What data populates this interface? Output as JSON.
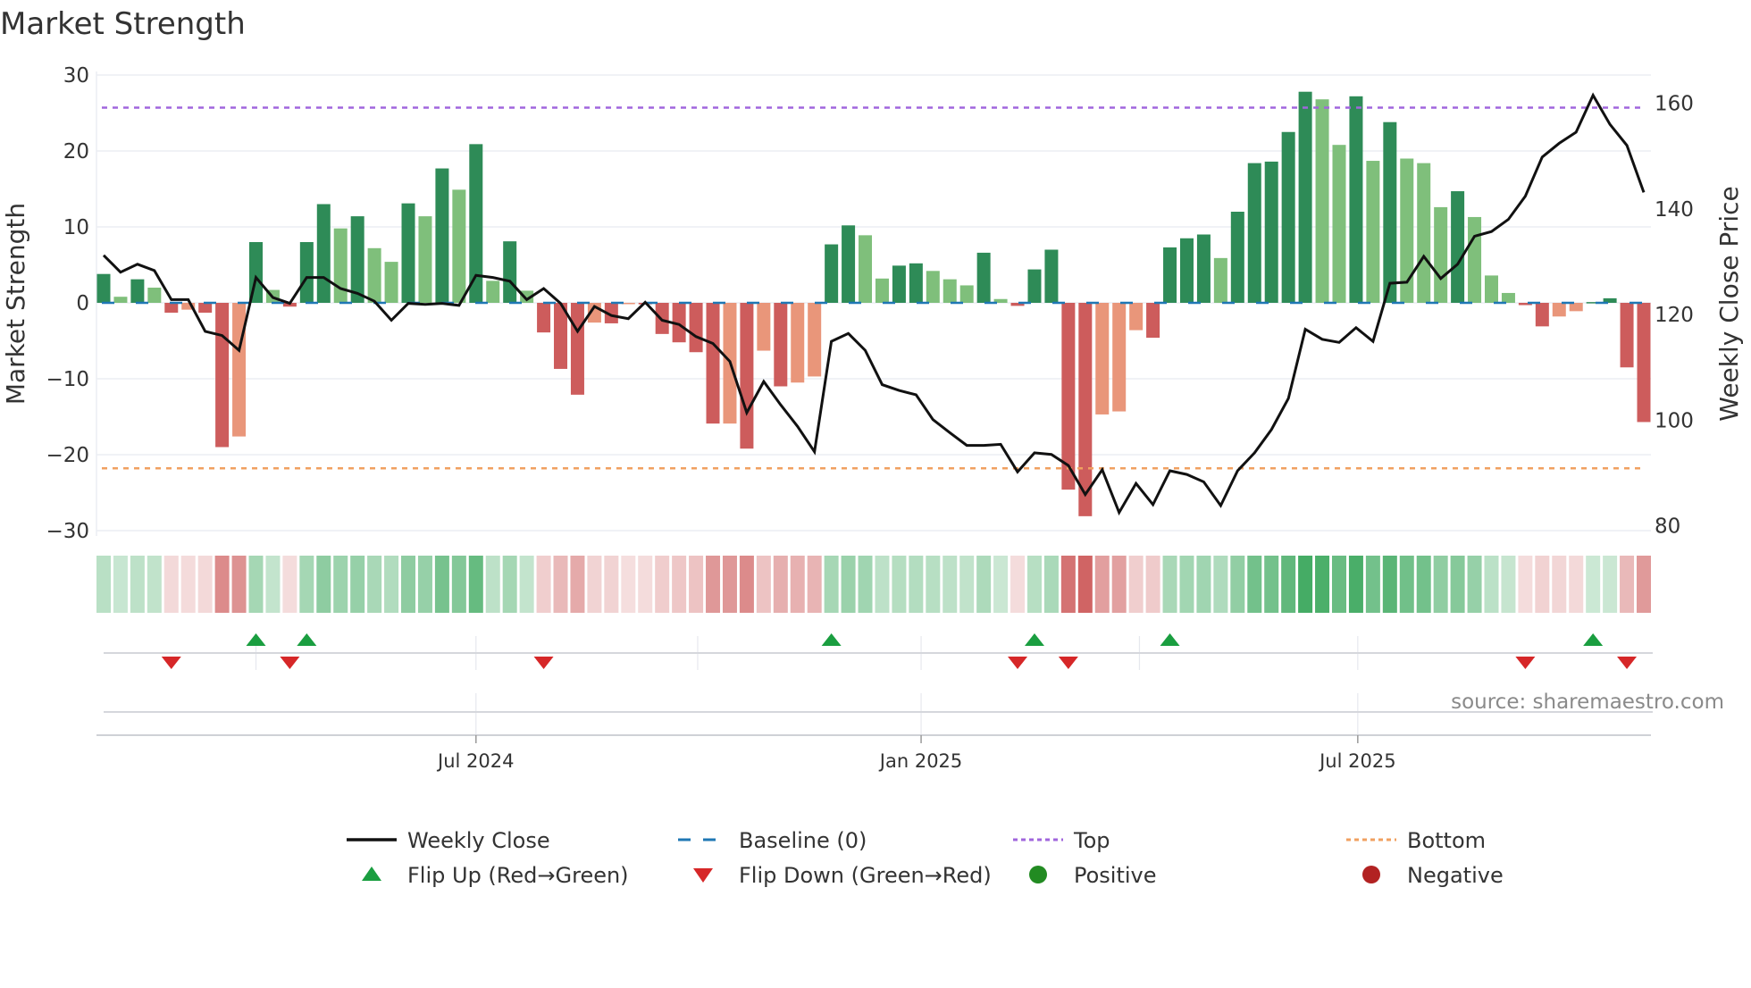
{
  "chart_data": {
    "type": "bar",
    "title": "Market Strength",
    "ylabel": "Market Strength",
    "y2label": "Weekly Close Price",
    "ylim": [
      -30,
      30
    ],
    "y2lim": [
      80,
      160
    ],
    "yticks": [
      30,
      20,
      10,
      0,
      -10,
      -20,
      -30
    ],
    "yticklabels": [
      "30",
      "20",
      "10",
      "0",
      "−10",
      "−20",
      "−30"
    ],
    "y2ticks": [
      160,
      140,
      120,
      100,
      80
    ],
    "y2ticklabels": [
      "160",
      "140",
      "120",
      "100",
      "80"
    ],
    "top_level": 25.7,
    "bottom_level": -21.8,
    "xlabel_ticks": [
      {
        "x": 22,
        "label": "Jul 2024"
      },
      {
        "x": 48.3,
        "label": "Jan 2025"
      },
      {
        "x": 74.1,
        "label": "Jul 2025"
      }
    ],
    "x_minor_grid": [
      9,
      35.1,
      61.2
    ],
    "strength": [
      3.8,
      0.8,
      3.1,
      2.0,
      -1.3,
      -0.9,
      -1.3,
      -19.0,
      -17.6,
      8.0,
      1.7,
      -0.5,
      8.0,
      13.0,
      9.8,
      11.4,
      7.2,
      5.4,
      13.1,
      11.4,
      17.7,
      14.9,
      20.9,
      2.9,
      8.1,
      1.6,
      -3.9,
      -8.7,
      -12.1,
      -2.6,
      -2.7,
      -0.1,
      -0.2,
      -4.1,
      -5.2,
      -6.5,
      -15.9,
      -15.9,
      -19.2,
      -6.3,
      -11.0,
      -10.5,
      -9.7,
      7.7,
      10.2,
      8.9,
      3.2,
      4.9,
      5.2,
      4.2,
      3.1,
      2.3,
      6.6,
      0.5,
      -0.4,
      4.4,
      7.0,
      -24.6,
      -28.1,
      -14.7,
      -14.3,
      -3.6,
      -4.6,
      7.3,
      8.5,
      9.0,
      5.9,
      12.0,
      18.4,
      18.6,
      22.5,
      27.8,
      26.8,
      20.8,
      27.2,
      18.7,
      23.8,
      19.0,
      18.4,
      12.6,
      14.7,
      11.3,
      3.6,
      1.3,
      -0.3,
      -3.1,
      -1.8,
      -1.1,
      0.1,
      0.6,
      -8.5,
      -15.7
    ],
    "weekly_close": [
      131.2,
      128.0,
      129.5,
      128.3,
      122.8,
      122.8,
      116.8,
      116.0,
      113.2,
      127.0,
      123.2,
      122.1,
      127.0,
      127.0,
      124.9,
      124.0,
      122.5,
      118.9,
      122.1,
      121.9,
      122.1,
      121.7,
      127.4,
      127.0,
      126.3,
      122.8,
      124.9,
      122.1,
      116.8,
      121.5,
      119.8,
      119.2,
      122.3,
      118.9,
      118.1,
      115.8,
      114.5,
      111.1,
      101.4,
      107.3,
      102.9,
      98.8,
      94.0,
      114.9,
      116.4,
      113.2,
      106.7,
      105.6,
      104.8,
      100.1,
      97.6,
      95.2,
      95.2,
      95.4,
      90.2,
      93.8,
      93.5,
      91.4,
      85.9,
      90.6,
      82.5,
      88.0,
      84.0,
      90.4,
      89.7,
      88.3,
      83.8,
      90.4,
      93.8,
      98.2,
      104.1,
      117.2,
      115.3,
      114.7,
      117.5,
      114.9,
      125.9,
      126.1,
      131.0,
      126.8,
      129.5,
      134.8,
      135.7,
      138.0,
      142.4,
      149.8,
      152.4,
      154.5,
      161.5,
      156.0,
      152.0,
      143.1
    ],
    "flip_up": [
      9,
      12,
      43,
      55,
      63,
      88
    ],
    "flip_down": [
      4,
      11,
      26,
      54,
      57,
      84,
      90
    ],
    "legend": [
      {
        "label": "Weekly Close",
        "symbol": "line"
      },
      {
        "label": "Baseline (0)",
        "symbol": "dash"
      },
      {
        "label": "Top",
        "symbol": "dot-purple"
      },
      {
        "label": "Bottom",
        "symbol": "dot-orange"
      },
      {
        "label": "Flip Up (Red→Green)",
        "symbol": "triangle-up"
      },
      {
        "label": "Flip Down (Green→Red)",
        "symbol": "triangle-down"
      },
      {
        "label": "Positive",
        "symbol": "circle-green"
      },
      {
        "label": "Negative",
        "symbol": "circle-red"
      }
    ],
    "legend_position": "bottom",
    "colors": {
      "pos_up": "#2e8b57",
      "pos_down": "#7fbf7b",
      "neg_down": "#cd5c5c",
      "neg_up": "#e9967a",
      "line": "#111111",
      "baseline": "#1f77b4",
      "top": "#a066dd",
      "bottom": "#f0a060",
      "flip_up": "#1a9e40",
      "flip_down": "#d62728",
      "positive": "#228b22",
      "negative": "#b22222"
    },
    "source": "source: sharemaestro.com"
  }
}
